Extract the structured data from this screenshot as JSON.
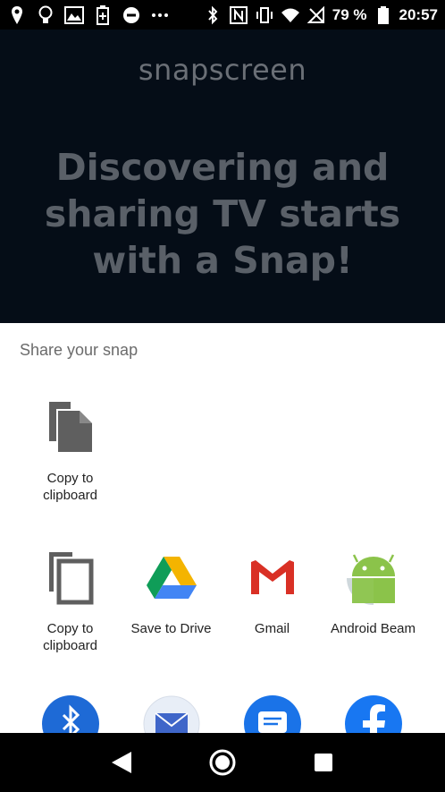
{
  "status_bar": {
    "battery_percent": "79 %",
    "time": "20:57",
    "icons": [
      "location-icon",
      "lightbulb-icon",
      "gallery-icon",
      "battery-saver-icon",
      "do-not-disturb-icon",
      "more-icon",
      "bluetooth-icon",
      "nfc-icon",
      "vibrate-icon",
      "wifi-icon",
      "no-signal-icon",
      "battery-icon"
    ]
  },
  "app": {
    "logo": "snapscreen",
    "headline": "Discovering and sharing TV starts with a Snap!"
  },
  "share_sheet": {
    "title": "Share your snap",
    "direct_targets": [
      {
        "label": "Copy to clipboard",
        "icon": "copy-icon"
      }
    ],
    "apps": [
      {
        "label": "Copy to clipboard",
        "icon": "copy-icon"
      },
      {
        "label": "Save to Drive",
        "icon": "google-drive-icon"
      },
      {
        "label": "Gmail",
        "icon": "gmail-icon"
      },
      {
        "label": "Android Beam",
        "icon": "android-beam-icon"
      }
    ],
    "partial_row": [
      {
        "icon": "bluetooth-icon",
        "color": "#1e6ad6"
      },
      {
        "icon": "email-icon",
        "color": "#e8eef7"
      },
      {
        "icon": "messages-icon",
        "color": "#1a73e8"
      },
      {
        "icon": "facebook-icon",
        "color": "#1877f2"
      }
    ]
  },
  "nav_bar": {
    "buttons": [
      "back-icon",
      "home-icon",
      "recents-icon"
    ]
  },
  "colors": {
    "app_background": "#050d17",
    "sheet_background": "#ffffff",
    "drive_green": "#0f9d58",
    "drive_yellow": "#f4b400",
    "drive_blue": "#4285f4",
    "gmail_red": "#d93025",
    "android_green": "#8bc34a"
  }
}
